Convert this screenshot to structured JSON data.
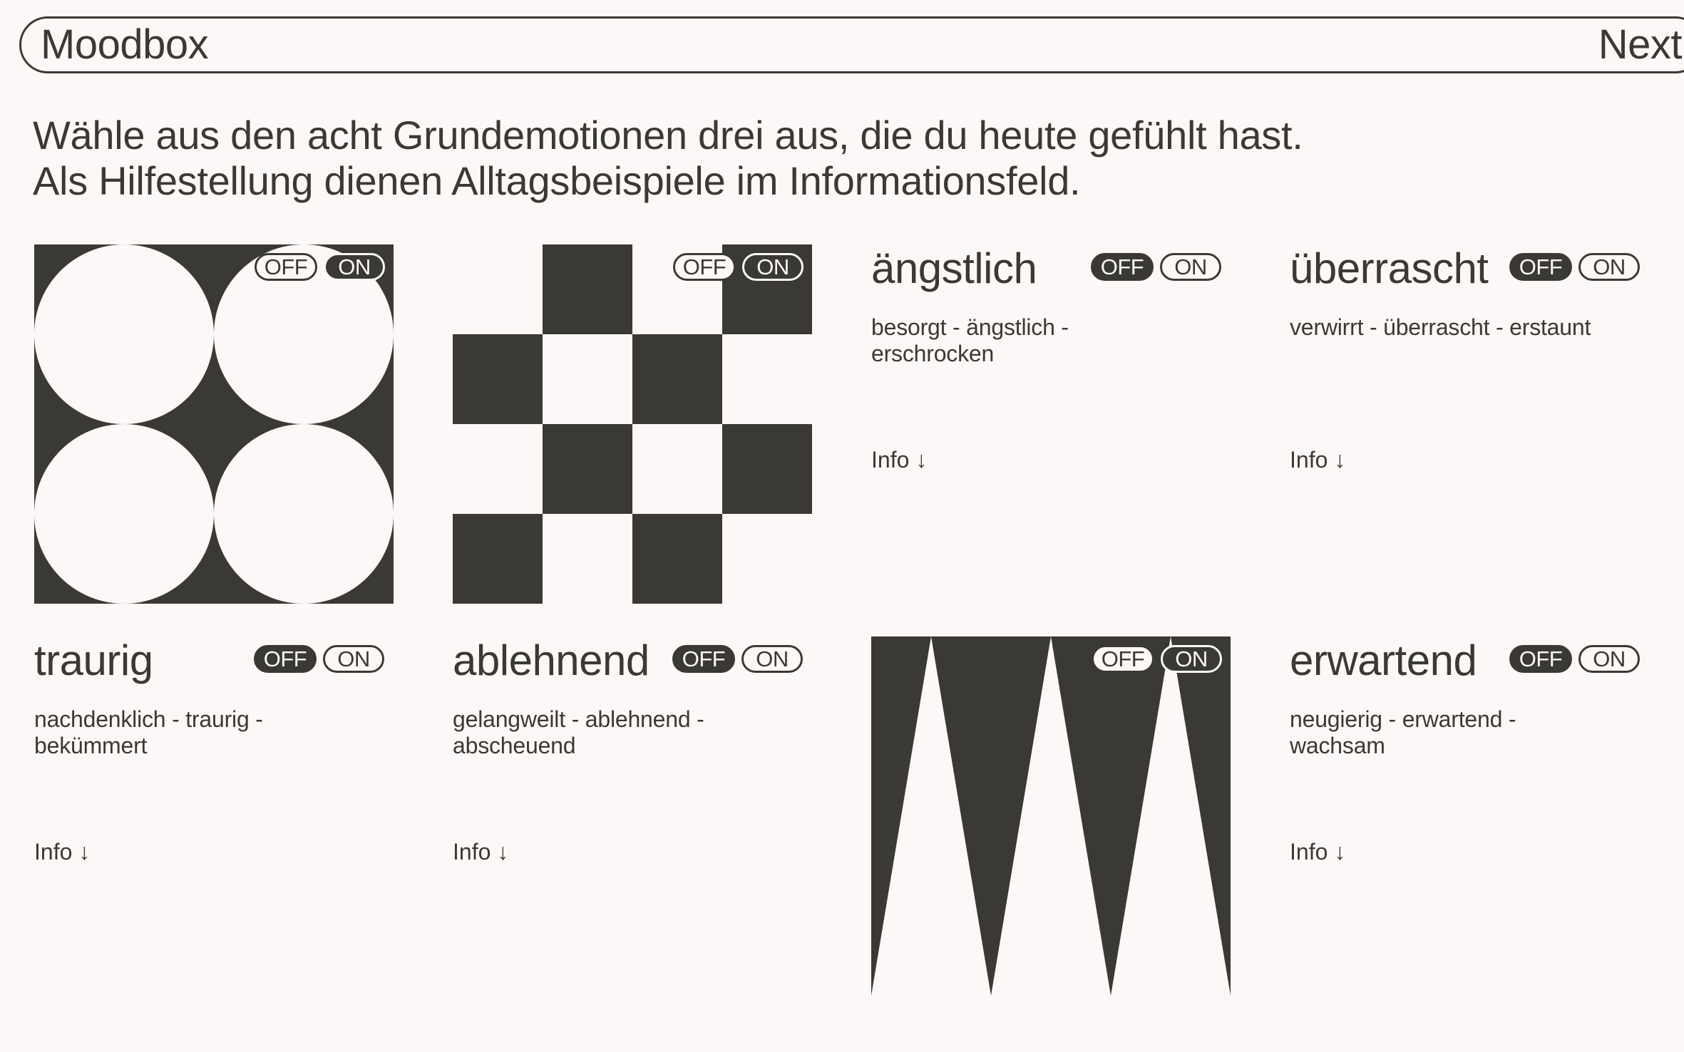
{
  "header": {
    "brand": "Moodbox",
    "next_label": "Next"
  },
  "intro": {
    "line1": "Wähle aus den acht Grundemotionen drei aus, die du heute gefühlt hast.",
    "line2": "Als Hilfestellung dienen Alltagsbeispiele im Informationsfeld."
  },
  "colors": {
    "ink": "#3a3934",
    "background": "#fcf8f7"
  },
  "toggle_labels": {
    "off": "OFF",
    "on": "ON"
  },
  "cards": [
    {
      "id": "pattern-circles",
      "type": "pattern",
      "pattern": "circles-grid",
      "selected": true
    },
    {
      "id": "pattern-checker",
      "type": "pattern",
      "pattern": "checkerboard",
      "selected": true
    },
    {
      "id": "aengstlich",
      "type": "text",
      "title": "ängstlich",
      "description": "besorgt - ängstlich - erschrocken",
      "info_label": "Info ↓",
      "selected": false
    },
    {
      "id": "ueberrascht",
      "type": "text",
      "title": "überrascht",
      "description": "verwirrt - überrascht - erstaunt",
      "info_label": "Info ↓",
      "selected": false
    },
    {
      "id": "traurig",
      "type": "text",
      "title": "traurig",
      "description": "nachdenklich - traurig - bekümmert",
      "info_label": "Info ↓",
      "selected": false
    },
    {
      "id": "ablehnend",
      "type": "text",
      "title": "ablehnend",
      "description": "gelangweilt - ablehnend - abscheuend",
      "info_label": "Info ↓",
      "selected": false
    },
    {
      "id": "pattern-spikes",
      "type": "pattern",
      "pattern": "triangle-spikes",
      "selected": true
    },
    {
      "id": "erwartend",
      "type": "text",
      "title": "erwartend",
      "description": "neugierig - erwartend - wachsam",
      "info_label": "Info ↓",
      "selected": false
    }
  ]
}
